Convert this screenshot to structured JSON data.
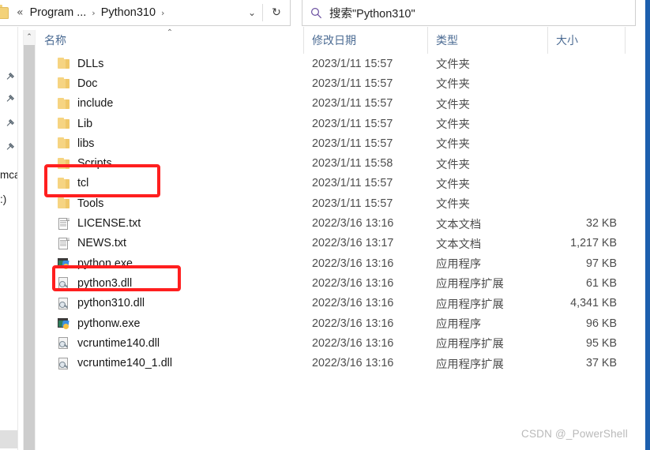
{
  "window": {
    "frame_accent_color": "#1d5fae"
  },
  "addressbar": {
    "folder_icon": "folder-icon",
    "overflow_chevron": "«",
    "crumbs": [
      {
        "label": "Program ...",
        "sep": "›"
      },
      {
        "label": "Python310",
        "sep": "›"
      }
    ],
    "dropdown_icon": "⌄",
    "refresh_icon": "↻"
  },
  "search": {
    "icon": "search-icon",
    "placeholder": "搜索\"Python310\""
  },
  "navpane": {
    "pins": [
      {
        "icon": "pin-icon"
      },
      {
        "icon": "pin-icon"
      },
      {
        "icon": "pin-icon"
      },
      {
        "icon": "pin-icon"
      }
    ],
    "clipped_labels": [
      {
        "text": "mcat"
      },
      {
        "text": ":)"
      }
    ],
    "scrollbar": {
      "up_arrow": "⌃"
    }
  },
  "columns": {
    "name": "名称",
    "date_modified": "修改日期",
    "type": "类型",
    "size": "大小",
    "sort_indicator": "⌃",
    "sort_column": "名称",
    "sort_direction": "ascending"
  },
  "rows": [
    {
      "name": "DLLs",
      "icon": "folder-icon",
      "date": "2023/1/11 15:57",
      "type": "文件夹",
      "size": ""
    },
    {
      "name": "Doc",
      "icon": "folder-icon",
      "date": "2023/1/11 15:57",
      "type": "文件夹",
      "size": ""
    },
    {
      "name": "include",
      "icon": "folder-icon",
      "date": "2023/1/11 15:57",
      "type": "文件夹",
      "size": ""
    },
    {
      "name": "Lib",
      "icon": "folder-icon",
      "date": "2023/1/11 15:57",
      "type": "文件夹",
      "size": ""
    },
    {
      "name": "libs",
      "icon": "folder-icon",
      "date": "2023/1/11 15:57",
      "type": "文件夹",
      "size": ""
    },
    {
      "name": "Scripts",
      "icon": "folder-icon",
      "date": "2023/1/11 15:58",
      "type": "文件夹",
      "size": ""
    },
    {
      "name": "tcl",
      "icon": "folder-icon",
      "date": "2023/1/11 15:57",
      "type": "文件夹",
      "size": ""
    },
    {
      "name": "Tools",
      "icon": "folder-icon",
      "date": "2023/1/11 15:57",
      "type": "文件夹",
      "size": ""
    },
    {
      "name": "LICENSE.txt",
      "icon": "text-file-icon",
      "date": "2022/3/16 13:16",
      "type": "文本文档",
      "size": "32 KB"
    },
    {
      "name": "NEWS.txt",
      "icon": "text-file-icon",
      "date": "2022/3/16 13:17",
      "type": "文本文档",
      "size": "1,217 KB"
    },
    {
      "name": "python.exe",
      "icon": "exe-file-icon",
      "date": "2022/3/16 13:16",
      "type": "应用程序",
      "size": "97 KB"
    },
    {
      "name": "python3.dll",
      "icon": "dll-file-icon",
      "date": "2022/3/16 13:16",
      "type": "应用程序扩展",
      "size": "61 KB"
    },
    {
      "name": "python310.dll",
      "icon": "dll-file-icon",
      "date": "2022/3/16 13:16",
      "type": "应用程序扩展",
      "size": "4,341 KB"
    },
    {
      "name": "pythonw.exe",
      "icon": "exe-file-icon",
      "date": "2022/3/16 13:16",
      "type": "应用程序",
      "size": "96 KB"
    },
    {
      "name": "vcruntime140.dll",
      "icon": "dll-file-icon",
      "date": "2022/3/16 13:16",
      "type": "应用程序扩展",
      "size": "95 KB"
    },
    {
      "name": "vcruntime140_1.dll",
      "icon": "dll-file-icon",
      "date": "2022/3/16 13:16",
      "type": "应用程序扩展",
      "size": "37 KB"
    }
  ],
  "annotations": {
    "color": "#ff1f1f",
    "boxes": [
      {
        "target": "Scripts"
      },
      {
        "target": "python.exe"
      }
    ]
  },
  "watermark": {
    "text": "CSDN @_PowerShell"
  }
}
